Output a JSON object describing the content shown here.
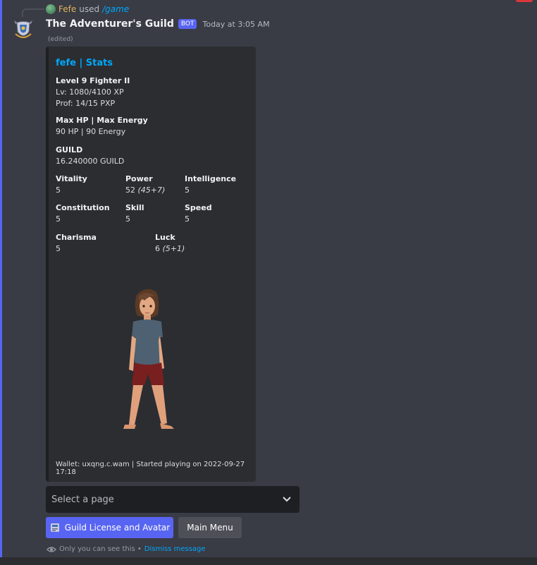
{
  "reply": {
    "user": "Fefe",
    "action": "used",
    "command": "/game"
  },
  "message": {
    "author": "The Adventurer's Guild",
    "badge": "BOT",
    "timestamp": "Today at 3:05 AM",
    "edited": "(edited)"
  },
  "embed": {
    "title": "fefe | Stats",
    "level": {
      "name": "Level 9 Fighter II",
      "line1": "Lv: 1080/4100 XP",
      "line2": "Prof: 14/15 PXP"
    },
    "maxhp": {
      "name": "Max HP | Max Energy",
      "value": "90 HP | 90 Energy"
    },
    "guild": {
      "name": "GUILD",
      "value": "16.240000 GUILD"
    },
    "stats": {
      "vitality": {
        "name": "Vitality",
        "value": "5"
      },
      "power": {
        "name": "Power",
        "value": "52",
        "extra": "(45+7)"
      },
      "intelligence": {
        "name": "Intelligence",
        "value": "5"
      },
      "constitution": {
        "name": "Constitution",
        "value": "5"
      },
      "skill": {
        "name": "Skill",
        "value": "5"
      },
      "speed": {
        "name": "Speed",
        "value": "5"
      },
      "charisma": {
        "name": "Charisma",
        "value": "5"
      },
      "luck": {
        "name": "Luck",
        "value": "6",
        "extra": "(5+1)"
      }
    },
    "footer": "Wallet: uxqng.c.wam | Started playing on 2022-09-27 17:18"
  },
  "select": {
    "placeholder": "Select a page"
  },
  "buttons": {
    "license": "Guild License and Avatar",
    "menu": "Main Menu"
  },
  "ephemeral": {
    "text": "Only you can see this •",
    "dismiss": "Dismiss message"
  },
  "colors": {
    "accent": "#5865f2",
    "link": "#00a8fc",
    "reply_name": "#e2b35b"
  },
  "icons": [
    "reply-avatar-icon",
    "guild-crest-icon",
    "chevron-down-icon",
    "license-card-icon",
    "eye-icon"
  ]
}
